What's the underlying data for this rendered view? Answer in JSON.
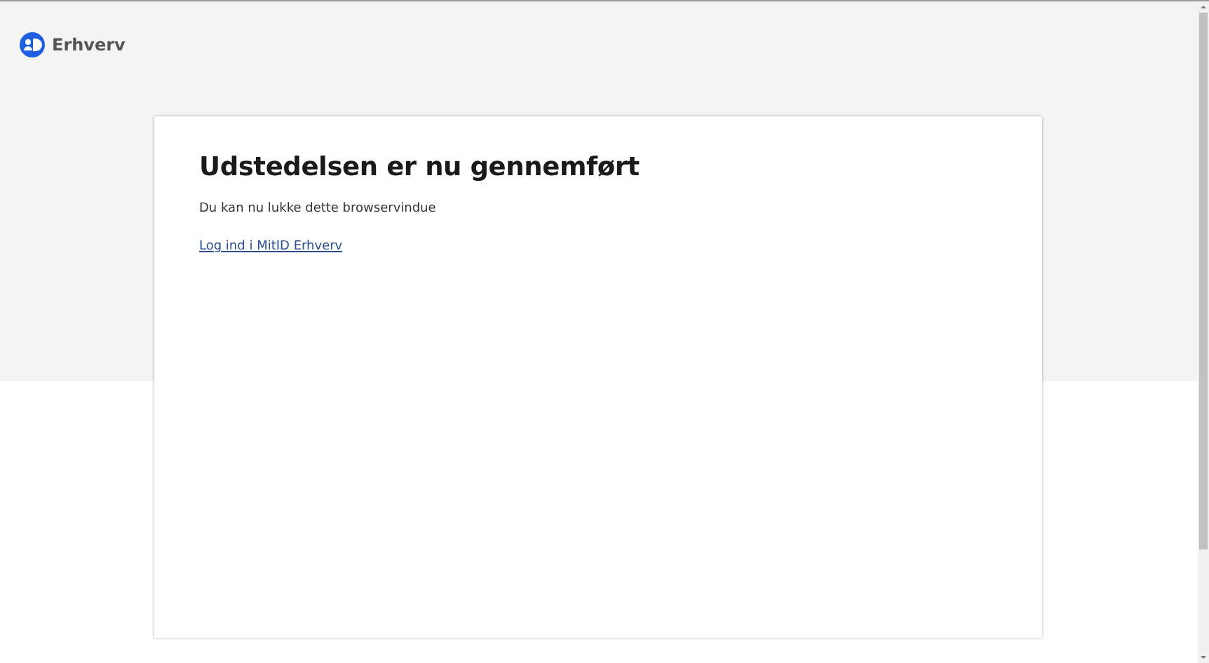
{
  "header": {
    "brand": "Erhverv"
  },
  "card": {
    "title": "Udstedelsen er nu gennemført",
    "message": "Du kan nu lukke dette browservindue",
    "link": "Log ind i MitID Erhverv"
  }
}
